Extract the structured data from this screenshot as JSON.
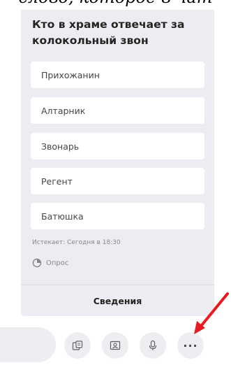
{
  "caption": "слово, которое в чат",
  "poll": {
    "question": "Кто в храме отвечает за колокольный звон",
    "options": [
      "Прихожанин",
      "Алтарник",
      "Звонарь",
      "Регент",
      "Батюшка"
    ],
    "expires": "Истекает: Сегодня в 18:30",
    "type_label": "Опрос",
    "details_label": "Сведения"
  },
  "toolbar": {
    "buttons": [
      "forms-icon",
      "contact-card-icon",
      "microphone-icon",
      "more-options-icon"
    ],
    "more_label": "···"
  },
  "colors": {
    "card_bg": "#edecf2",
    "arrow": "#e8191f"
  }
}
